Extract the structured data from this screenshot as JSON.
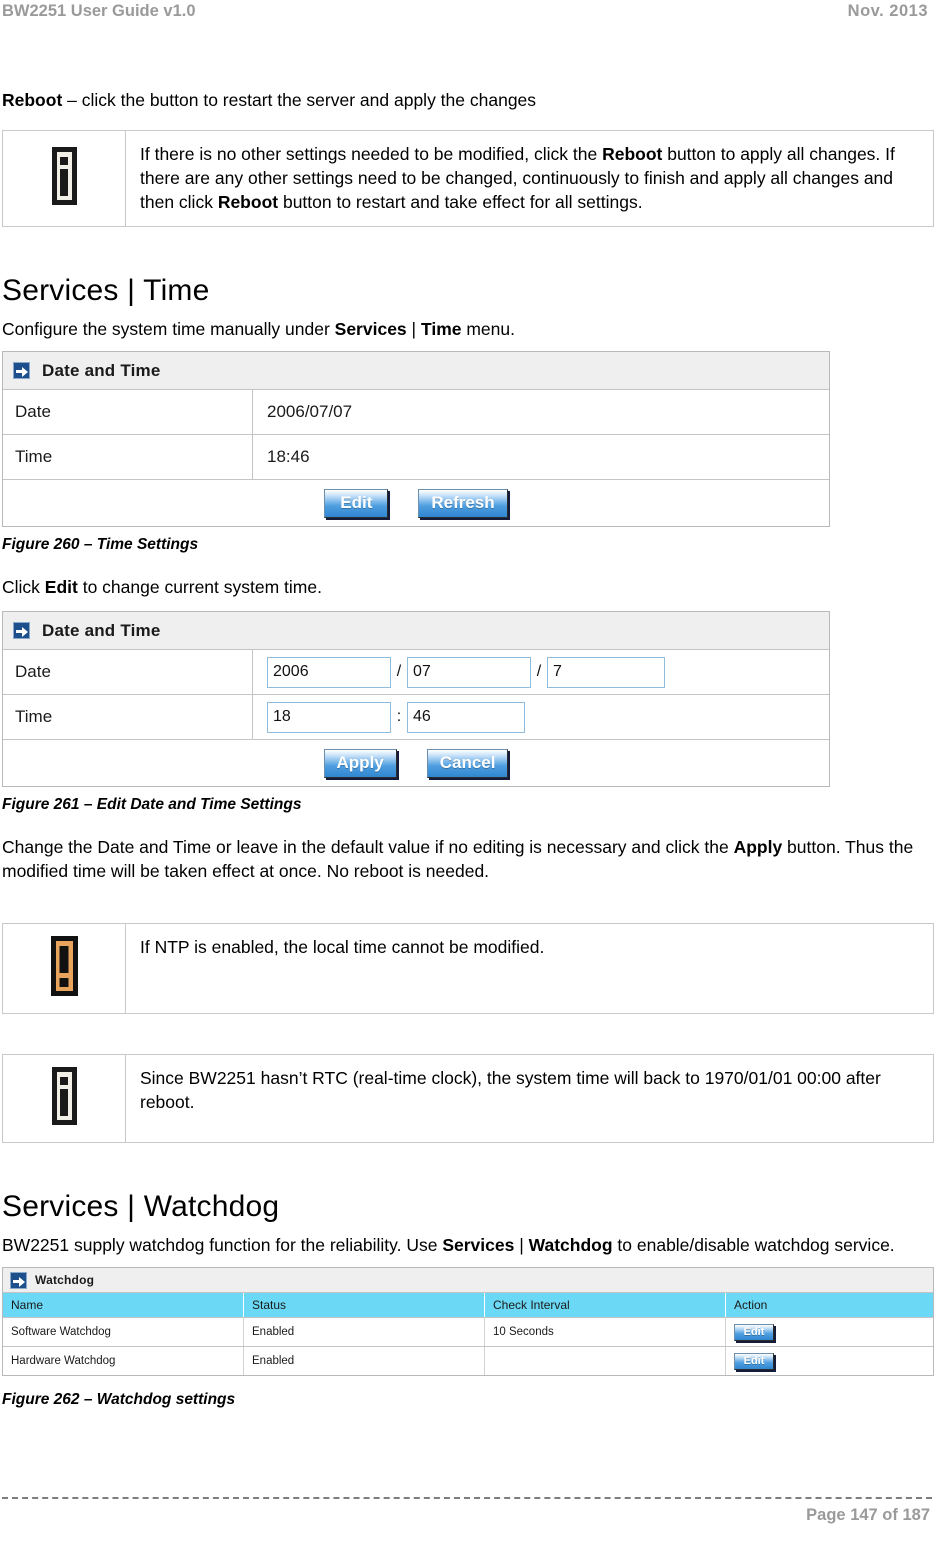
{
  "header": {
    "left": "BW2251 User Guide v1.0",
    "right": "Nov.  2013"
  },
  "reboot_paragraph": {
    "bold": "Reboot",
    "rest": " – click the button to restart the server and apply the changes"
  },
  "note_reboot": {
    "icon": "info-icon",
    "text_part1": "If there is no other settings needed to be modified, click the ",
    "bold1": "Reboot",
    "text_part2": " button to apply all changes. If there are any other settings need to be changed, continuously to finish and apply all changes and then click ",
    "bold2": "Reboot",
    "text_part3": " button to restart and take effect  for all settings."
  },
  "section_time": {
    "title": "Services | Time",
    "intro_part1": "Configure the system time manually under ",
    "intro_bold1": "Services",
    "intro_mid": " | ",
    "intro_bold2": "Time",
    "intro_part2": " menu."
  },
  "figure260": {
    "panel_title": "Date and Time",
    "panel_icon": "blue-arrow-icon",
    "rows": [
      {
        "label": "Date",
        "value": "2006/07/07"
      },
      {
        "label": "Time",
        "value": "18:46"
      }
    ],
    "buttons": [
      {
        "name": "edit-button",
        "label": "Edit"
      },
      {
        "name": "refresh-button",
        "label": "Refresh"
      }
    ],
    "caption": "Figure 260 – Time Settings"
  },
  "click_edit": {
    "part1": "Click ",
    "bold": "Edit",
    "part2": " to change current system time."
  },
  "figure261": {
    "panel_title": "Date and Time",
    "panel_icon": "blue-arrow-icon",
    "date_row": {
      "label": "Date",
      "year": "2006",
      "sep1": "/",
      "month": "07",
      "sep2": "/",
      "day": "7"
    },
    "time_row": {
      "label": "Time",
      "hour": "18",
      "sep": ":",
      "minute": "46"
    },
    "buttons": [
      {
        "name": "apply-button",
        "label": "Apply"
      },
      {
        "name": "cancel-button",
        "label": "Cancel"
      }
    ],
    "caption": "Figure 261 – Edit Date and Time Settings"
  },
  "change_paragraph": {
    "part1": "Change the Date and Time or leave in the default value if no editing is necessary and click the ",
    "bold": "Apply",
    "part2": " button. Thus the modified time will be taken effect at once. No reboot is needed."
  },
  "warning_ntp": {
    "icon": "warning-icon",
    "text": "If NTP is enabled, the local time cannot be modified."
  },
  "note_rtc": {
    "icon": "info-icon",
    "text": "Since BW2251 hasn’t RTC (real-time clock), the system time will back to 1970/01/01 00:00 after reboot."
  },
  "section_watchdog": {
    "title": "Services | Watchdog",
    "intro_part1": "BW2251 supply watchdog function for the reliability. Use ",
    "intro_bold1": "Services",
    "intro_mid": " | ",
    "intro_bold2": "Watchdog",
    "intro_part2": " to enable/disable watchdog service."
  },
  "figure262": {
    "panel_title": "Watchdog",
    "panel_icon": "blue-arrow-icon",
    "columns": [
      "Name",
      "Status",
      "Check Interval",
      "Action"
    ],
    "rows": [
      {
        "name": "Software Watchdog",
        "status": "Enabled",
        "interval": "10 Seconds",
        "action": "Edit"
      },
      {
        "name": "Hardware Watchdog",
        "status": "Enabled",
        "interval": "",
        "action": "Edit"
      }
    ],
    "caption": "Figure 262 – Watchdog settings"
  },
  "footer": {
    "page_label": "Page 147 of 187"
  },
  "colors": {
    "header_gray": "#9a9a9a",
    "table_header_cyan": "#6bd9f5",
    "panel_header_gray": "#efefef",
    "button_blue": "#4f9fe0",
    "warning_orange": "#e8a35c",
    "panel_icon_blue": "#1c4f8b"
  }
}
